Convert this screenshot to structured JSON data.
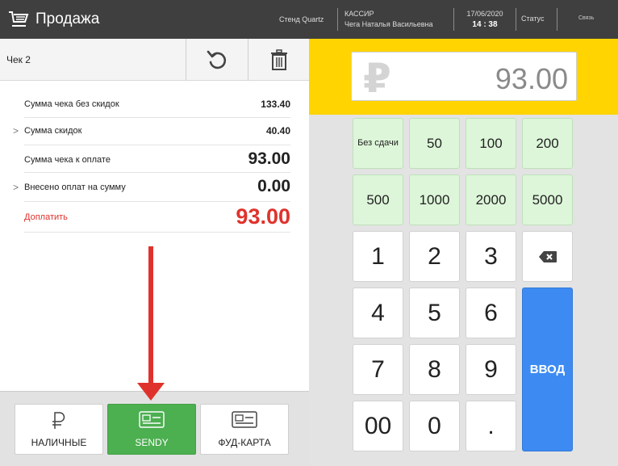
{
  "header": {
    "title": "Продажа",
    "stand": "Стенд Quartz",
    "cashier_role": "КАССИР",
    "cashier_name": "Чега Наталья Васильевна",
    "date": "17/06/2020",
    "time": "14 : 38",
    "status_label": "Статус",
    "link_label": "Связь"
  },
  "check": {
    "label": "Чек 2",
    "undo_icon": "undo-icon",
    "trash_icon": "trash-icon"
  },
  "summary": {
    "rows": [
      {
        "label": "Сумма чека без скидок",
        "value": "133.40"
      },
      {
        "label": "Сумма скидок",
        "value": "40.40"
      },
      {
        "label": "Сумма чека к оплате",
        "value": "93.00"
      },
      {
        "label": "Внесено оплат на сумму",
        "value": "0.00"
      },
      {
        "label": "Доплатить",
        "value": "93.00"
      }
    ]
  },
  "payment_methods": [
    {
      "label": "НАЛИЧНЫЕ",
      "icon": "ruble-icon",
      "active": false
    },
    {
      "label": "SENDY",
      "icon": "card-icon",
      "active": true
    },
    {
      "label": "ФУД-КАРТА",
      "icon": "card-icon",
      "active": false
    }
  ],
  "display": {
    "currency_symbol": "₽",
    "amount": "93.00"
  },
  "keypad": {
    "no_change": "Без сдачи",
    "quick": [
      "50",
      "100",
      "200",
      "500",
      "1000",
      "2000",
      "5000"
    ],
    "digits": [
      "1",
      "2",
      "3",
      "4",
      "5",
      "6",
      "7",
      "8",
      "9",
      "00",
      "0",
      "."
    ],
    "backspace_icon": "backspace-icon",
    "enter": "ВВОД"
  },
  "colors": {
    "header_bg": "#3f3f3f",
    "accent_yellow": "#ffd400",
    "quick_key_bg": "#ddf6d9",
    "active_payment": "#4caf50",
    "enter_key": "#3d8bf2",
    "due_red": "#e0322c"
  }
}
